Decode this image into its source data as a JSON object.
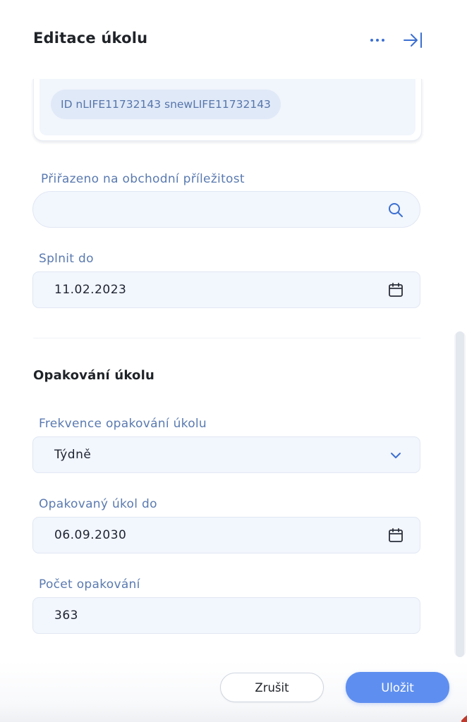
{
  "header": {
    "title": "Editace úkolu"
  },
  "card": {
    "id_chip": "ID nLIFE11732143 snewLIFE11732143"
  },
  "fields": {
    "opportunity": {
      "label": "Přiřazeno na obchodní příležitost",
      "value": "",
      "placeholder": ""
    },
    "due_date": {
      "label": "Splnit do",
      "value": "11.02.2023"
    }
  },
  "repeat": {
    "section_title": "Opakování úkolu",
    "frequency": {
      "label": "Frekvence opakování úkolu",
      "value": "Týdně"
    },
    "repeat_until": {
      "label": "Opakovaný úkol do",
      "value": "06.09.2030"
    },
    "repeat_count": {
      "label": "Počet opakování",
      "value": "363"
    }
  },
  "footer": {
    "cancel_label": "Zrušit",
    "save_label": "Uložit"
  },
  "colors": {
    "accent": "#5e8ff0",
    "label": "#5a7ab0",
    "input_bg": "#f2f6fd",
    "icon": "#3b6fd1"
  },
  "icons": {
    "more": "more-horizontal-icon",
    "collapse": "collapse-panel-icon",
    "search": "search-icon",
    "calendar": "calendar-icon",
    "chevron": "chevron-down-icon"
  }
}
